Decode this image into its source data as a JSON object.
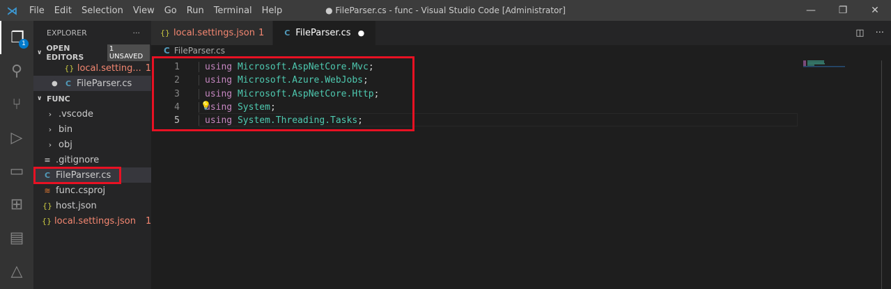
{
  "titlebar": {
    "menu": [
      "File",
      "Edit",
      "Selection",
      "View",
      "Go",
      "Run",
      "Terminal",
      "Help"
    ],
    "title": "● FileParser.cs - func - Visual Studio Code [Administrator]",
    "minimize": "—",
    "restore": "❐",
    "close": "✕"
  },
  "activity": {
    "explorer_badge": "1"
  },
  "sidebar": {
    "title": "EXPLORER",
    "more": "···",
    "open_editors": {
      "label": "OPEN EDITORS",
      "unsaved": "1 UNSAVED",
      "items": [
        {
          "name": "local.setting...",
          "problems": "1"
        },
        {
          "name": "FileParser.cs"
        }
      ]
    },
    "folder": {
      "label": "FUNC",
      "items": [
        ".vscode",
        "bin",
        "obj",
        ".gitignore",
        "FileParser.cs",
        "func.csproj",
        "host.json",
        "local.settings.json"
      ],
      "local_problems": "1"
    }
  },
  "tabs": [
    {
      "label": "local.settings.json",
      "problems": "1"
    },
    {
      "label": "FileParser.cs",
      "dirty": "●"
    }
  ],
  "breadcrumb": "FileParser.cs",
  "code": [
    {
      "n": "1",
      "kw": "using",
      "ns": "Microsoft.AspNetCore.Mvc"
    },
    {
      "n": "2",
      "kw": "using",
      "ns": "Microsoft.Azure.WebJobs"
    },
    {
      "n": "3",
      "kw": "using",
      "ns": "Microsoft.AspNetCore.Http"
    },
    {
      "n": "4",
      "kw": "using",
      "ns": "System"
    },
    {
      "n": "5",
      "kw": "using",
      "ns": "System.Threading.Tasks"
    }
  ],
  "semicolon": ";"
}
